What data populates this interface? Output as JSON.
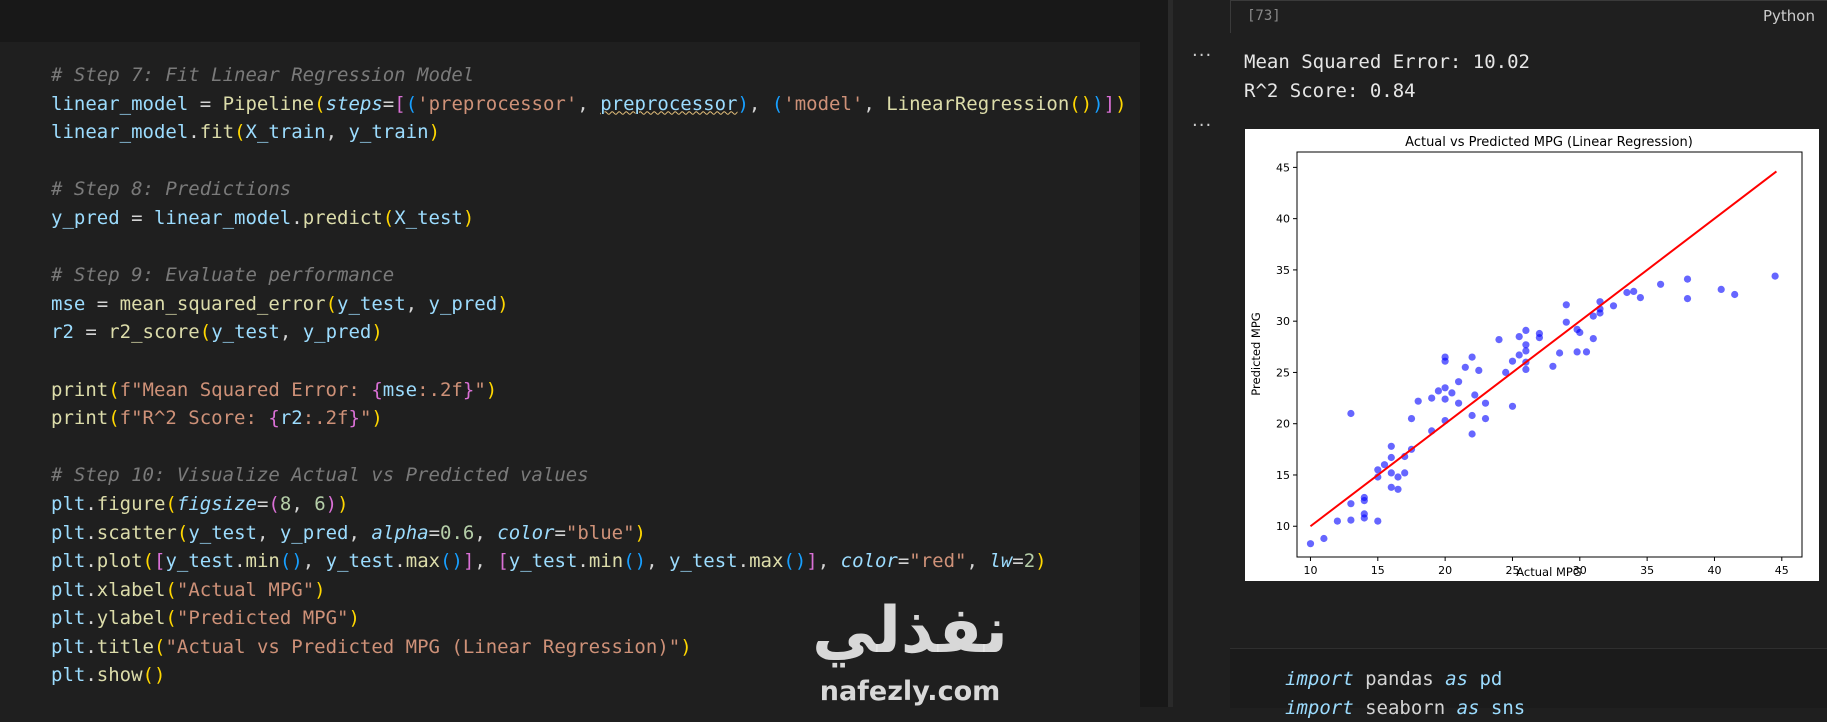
{
  "editor": {
    "lines": [
      {
        "segments": [
          {
            "t": "# Step 7: Fit Linear Regression Model",
            "c": "cm"
          }
        ]
      },
      {
        "segments": [
          {
            "t": "linear_model",
            "c": "v"
          },
          {
            "t": " = ",
            "c": "op"
          },
          {
            "t": "Pipeline",
            "c": "f"
          },
          {
            "t": "(",
            "c": "b1"
          },
          {
            "t": "steps",
            "c": "k"
          },
          {
            "t": "=",
            "c": "op"
          },
          {
            "t": "[",
            "c": "b2"
          },
          {
            "t": "(",
            "c": "b3"
          },
          {
            "t": "'preprocessor'",
            "c": "s"
          },
          {
            "t": ", ",
            "c": "op"
          },
          {
            "t": "preprocessor",
            "c": "v squig"
          },
          {
            "t": ")",
            "c": "b3"
          },
          {
            "t": ", ",
            "c": "op"
          },
          {
            "t": "(",
            "c": "b3"
          },
          {
            "t": "'model'",
            "c": "s"
          },
          {
            "t": ", ",
            "c": "op"
          },
          {
            "t": "LinearRegression",
            "c": "f"
          },
          {
            "t": "()",
            "c": "b1"
          },
          {
            "t": ")",
            "c": "b3"
          },
          {
            "t": "]",
            "c": "b2"
          },
          {
            "t": ")",
            "c": "b1"
          }
        ]
      },
      {
        "segments": [
          {
            "t": "linear_model",
            "c": "v"
          },
          {
            "t": ".",
            "c": "op"
          },
          {
            "t": "fit",
            "c": "f"
          },
          {
            "t": "(",
            "c": "b1"
          },
          {
            "t": "X_train",
            "c": "v"
          },
          {
            "t": ", ",
            "c": "op"
          },
          {
            "t": "y_train",
            "c": "v"
          },
          {
            "t": ")",
            "c": "b1"
          }
        ]
      },
      {
        "segments": []
      },
      {
        "segments": [
          {
            "t": "# Step 8: Predictions",
            "c": "cm"
          }
        ]
      },
      {
        "segments": [
          {
            "t": "y_pred",
            "c": "v"
          },
          {
            "t": " = ",
            "c": "op"
          },
          {
            "t": "linear_model",
            "c": "v"
          },
          {
            "t": ".",
            "c": "op"
          },
          {
            "t": "predict",
            "c": "f"
          },
          {
            "t": "(",
            "c": "b1"
          },
          {
            "t": "X_test",
            "c": "v"
          },
          {
            "t": ")",
            "c": "b1"
          }
        ]
      },
      {
        "segments": []
      },
      {
        "segments": [
          {
            "t": "# Step 9: Evaluate performance",
            "c": "cm"
          }
        ]
      },
      {
        "segments": [
          {
            "t": "mse",
            "c": "v"
          },
          {
            "t": " = ",
            "c": "op"
          },
          {
            "t": "mean_squared_error",
            "c": "f"
          },
          {
            "t": "(",
            "c": "b1"
          },
          {
            "t": "y_test",
            "c": "v"
          },
          {
            "t": ", ",
            "c": "op"
          },
          {
            "t": "y_pred",
            "c": "v"
          },
          {
            "t": ")",
            "c": "b1"
          }
        ]
      },
      {
        "segments": [
          {
            "t": "r2",
            "c": "v"
          },
          {
            "t": " = ",
            "c": "op"
          },
          {
            "t": "r2_score",
            "c": "f"
          },
          {
            "t": "(",
            "c": "b1"
          },
          {
            "t": "y_test",
            "c": "v"
          },
          {
            "t": ", ",
            "c": "op"
          },
          {
            "t": "y_pred",
            "c": "v"
          },
          {
            "t": ")",
            "c": "b1"
          }
        ]
      },
      {
        "segments": []
      },
      {
        "segments": [
          {
            "t": "print",
            "c": "f"
          },
          {
            "t": "(",
            "c": "b1"
          },
          {
            "t": "f\"Mean Squared Error: ",
            "c": "s"
          },
          {
            "t": "{",
            "c": "b2"
          },
          {
            "t": "mse",
            "c": "v"
          },
          {
            "t": ":.2f",
            "c": "s"
          },
          {
            "t": "}",
            "c": "b2"
          },
          {
            "t": "\"",
            "c": "s"
          },
          {
            "t": ")",
            "c": "b1"
          }
        ]
      },
      {
        "segments": [
          {
            "t": "print",
            "c": "f"
          },
          {
            "t": "(",
            "c": "b1"
          },
          {
            "t": "f\"R^2 Score: ",
            "c": "s"
          },
          {
            "t": "{",
            "c": "b2"
          },
          {
            "t": "r2",
            "c": "v"
          },
          {
            "t": ":.2f",
            "c": "s"
          },
          {
            "t": "}",
            "c": "b2"
          },
          {
            "t": "\"",
            "c": "s"
          },
          {
            "t": ")",
            "c": "b1"
          }
        ]
      },
      {
        "segments": []
      },
      {
        "segments": [
          {
            "t": "# Step 10: Visualize Actual vs Predicted values",
            "c": "cm"
          }
        ]
      },
      {
        "segments": [
          {
            "t": "plt",
            "c": "v"
          },
          {
            "t": ".",
            "c": "op"
          },
          {
            "t": "figure",
            "c": "f"
          },
          {
            "t": "(",
            "c": "b1"
          },
          {
            "t": "figsize",
            "c": "k"
          },
          {
            "t": "=",
            "c": "op"
          },
          {
            "t": "(",
            "c": "b2"
          },
          {
            "t": "8",
            "c": "n"
          },
          {
            "t": ", ",
            "c": "op"
          },
          {
            "t": "6",
            "c": "n"
          },
          {
            "t": ")",
            "c": "b2"
          },
          {
            "t": ")",
            "c": "b1"
          }
        ]
      },
      {
        "segments": [
          {
            "t": "plt",
            "c": "v"
          },
          {
            "t": ".",
            "c": "op"
          },
          {
            "t": "scatter",
            "c": "f"
          },
          {
            "t": "(",
            "c": "b1"
          },
          {
            "t": "y_test",
            "c": "v"
          },
          {
            "t": ", ",
            "c": "op"
          },
          {
            "t": "y_pred",
            "c": "v"
          },
          {
            "t": ", ",
            "c": "op"
          },
          {
            "t": "alpha",
            "c": "k"
          },
          {
            "t": "=",
            "c": "op"
          },
          {
            "t": "0.6",
            "c": "n"
          },
          {
            "t": ", ",
            "c": "op"
          },
          {
            "t": "color",
            "c": "k"
          },
          {
            "t": "=",
            "c": "op"
          },
          {
            "t": "\"blue\"",
            "c": "s"
          },
          {
            "t": ")",
            "c": "b1"
          }
        ]
      },
      {
        "segments": [
          {
            "t": "plt",
            "c": "v"
          },
          {
            "t": ".",
            "c": "op"
          },
          {
            "t": "plot",
            "c": "f"
          },
          {
            "t": "(",
            "c": "b1"
          },
          {
            "t": "[",
            "c": "b2"
          },
          {
            "t": "y_test",
            "c": "v"
          },
          {
            "t": ".",
            "c": "op"
          },
          {
            "t": "min",
            "c": "f"
          },
          {
            "t": "()",
            "c": "b3"
          },
          {
            "t": ", ",
            "c": "op"
          },
          {
            "t": "y_test",
            "c": "v"
          },
          {
            "t": ".",
            "c": "op"
          },
          {
            "t": "max",
            "c": "f"
          },
          {
            "t": "()",
            "c": "b3"
          },
          {
            "t": "]",
            "c": "b2"
          },
          {
            "t": ", ",
            "c": "op"
          },
          {
            "t": "[",
            "c": "b2"
          },
          {
            "t": "y_test",
            "c": "v"
          },
          {
            "t": ".",
            "c": "op"
          },
          {
            "t": "min",
            "c": "f"
          },
          {
            "t": "()",
            "c": "b3"
          },
          {
            "t": ", ",
            "c": "op"
          },
          {
            "t": "y_test",
            "c": "v"
          },
          {
            "t": ".",
            "c": "op"
          },
          {
            "t": "max",
            "c": "f"
          },
          {
            "t": "()",
            "c": "b3"
          },
          {
            "t": "]",
            "c": "b2"
          },
          {
            "t": ", ",
            "c": "op"
          },
          {
            "t": "color",
            "c": "k"
          },
          {
            "t": "=",
            "c": "op"
          },
          {
            "t": "\"red\"",
            "c": "s"
          },
          {
            "t": ", ",
            "c": "op"
          },
          {
            "t": "lw",
            "c": "k"
          },
          {
            "t": "=",
            "c": "op"
          },
          {
            "t": "2",
            "c": "n"
          },
          {
            "t": ")",
            "c": "b1"
          }
        ]
      },
      {
        "segments": [
          {
            "t": "plt",
            "c": "v"
          },
          {
            "t": ".",
            "c": "op"
          },
          {
            "t": "xlabel",
            "c": "f"
          },
          {
            "t": "(",
            "c": "b1"
          },
          {
            "t": "\"Actual MPG\"",
            "c": "s"
          },
          {
            "t": ")",
            "c": "b1"
          }
        ]
      },
      {
        "segments": [
          {
            "t": "plt",
            "c": "v"
          },
          {
            "t": ".",
            "c": "op"
          },
          {
            "t": "ylabel",
            "c": "f"
          },
          {
            "t": "(",
            "c": "b1"
          },
          {
            "t": "\"Predicted MPG\"",
            "c": "s"
          },
          {
            "t": ")",
            "c": "b1"
          }
        ]
      },
      {
        "segments": [
          {
            "t": "plt",
            "c": "v"
          },
          {
            "t": ".",
            "c": "op"
          },
          {
            "t": "title",
            "c": "f"
          },
          {
            "t": "(",
            "c": "b1"
          },
          {
            "t": "\"Actual vs Predicted MPG (Linear Regression)\"",
            "c": "s"
          },
          {
            "t": ")",
            "c": "b1"
          }
        ]
      },
      {
        "segments": [
          {
            "t": "plt",
            "c": "v"
          },
          {
            "t": ".",
            "c": "op"
          },
          {
            "t": "show",
            "c": "f"
          },
          {
            "t": "()",
            "c": "b1"
          }
        ]
      }
    ]
  },
  "cell": {
    "exec_count": "[73]",
    "language": "Python",
    "output_line_1": "Mean Squared Error: 10.02",
    "output_line_2": "R^2 Score: 0.84",
    "more_actions": "..."
  },
  "next_cell": {
    "line_1": [
      {
        "t": "import",
        "c": "k"
      },
      {
        "t": " pandas ",
        "c": "op"
      },
      {
        "t": "as",
        "c": "k"
      },
      {
        "t": " pd",
        "c": "v"
      }
    ],
    "line_2": [
      {
        "t": "import",
        "c": "k"
      },
      {
        "t": " seaborn ",
        "c": "op"
      },
      {
        "t": "as",
        "c": "k"
      },
      {
        "t": " sns",
        "c": "v"
      }
    ]
  },
  "watermark": {
    "arabic": "نفذلي",
    "latin": "nafezly.com"
  },
  "chart_data": {
    "type": "scatter",
    "title": "Actual vs Predicted MPG (Linear Regression)",
    "xlabel": "Actual MPG",
    "ylabel": "Predicted MPG",
    "xlim": [
      9,
      46.5
    ],
    "ylim": [
      7,
      46.5
    ],
    "xticks": [
      10,
      15,
      20,
      25,
      30,
      35,
      40,
      45
    ],
    "yticks": [
      10,
      15,
      20,
      25,
      30,
      35,
      40,
      45
    ],
    "grid": false,
    "colors": {
      "points": "#0000ff",
      "line": "#ff0000"
    },
    "reference_line": {
      "x": [
        10,
        44.6
      ],
      "y": [
        10,
        44.6
      ]
    },
    "points": [
      [
        10,
        8.3
      ],
      [
        11,
        8.8
      ],
      [
        12,
        10.5
      ],
      [
        13,
        21
      ],
      [
        13,
        10.6
      ],
      [
        13,
        12.2
      ],
      [
        14,
        11.2
      ],
      [
        14,
        12.8
      ],
      [
        14,
        10.8
      ],
      [
        14,
        12.5
      ],
      [
        15,
        10.5
      ],
      [
        15,
        14.8
      ],
      [
        15,
        15.5
      ],
      [
        15.5,
        16
      ],
      [
        16,
        16.7
      ],
      [
        16,
        13.8
      ],
      [
        16,
        15.2
      ],
      [
        16,
        17.8
      ],
      [
        16.5,
        14.8
      ],
      [
        16.5,
        13.6
      ],
      [
        17,
        16.8
      ],
      [
        17,
        15.2
      ],
      [
        17.5,
        17.5
      ],
      [
        17.5,
        20.5
      ],
      [
        18,
        22.2
      ],
      [
        19,
        19.3
      ],
      [
        19,
        22.5
      ],
      [
        19.5,
        23.2
      ],
      [
        20,
        20.3
      ],
      [
        20,
        22.4
      ],
      [
        20,
        23.5
      ],
      [
        20,
        26.5
      ],
      [
        20,
        26.1
      ],
      [
        20.5,
        23
      ],
      [
        21,
        22
      ],
      [
        21,
        24.1
      ],
      [
        21.5,
        25.5
      ],
      [
        22,
        26.5
      ],
      [
        22,
        19
      ],
      [
        22,
        20.8
      ],
      [
        22.2,
        22.8
      ],
      [
        22.5,
        25.2
      ],
      [
        23,
        20.5
      ],
      [
        23,
        22
      ],
      [
        24,
        28.2
      ],
      [
        24.5,
        25
      ],
      [
        25,
        21.7
      ],
      [
        25,
        26.1
      ],
      [
        25.5,
        26.7
      ],
      [
        25.5,
        28.5
      ],
      [
        26,
        27.1
      ],
      [
        26,
        27.7
      ],
      [
        26,
        26
      ],
      [
        26,
        25.3
      ],
      [
        26,
        29.1
      ],
      [
        27,
        28.4
      ],
      [
        27,
        28.8
      ],
      [
        28,
        25.6
      ],
      [
        28.5,
        26.9
      ],
      [
        29,
        29.9
      ],
      [
        29,
        31.6
      ],
      [
        29.8,
        29.2
      ],
      [
        29.8,
        27
      ],
      [
        30,
        28.9
      ],
      [
        30.5,
        27
      ],
      [
        31,
        28.3
      ],
      [
        31,
        30.5
      ],
      [
        31.5,
        31.2
      ],
      [
        31.5,
        31.9
      ],
      [
        31.5,
        30.8
      ],
      [
        32.5,
        31.5
      ],
      [
        33.5,
        32.8
      ],
      [
        34,
        32.9
      ],
      [
        34.5,
        32.3
      ],
      [
        36,
        33.6
      ],
      [
        38,
        34.1
      ],
      [
        38,
        32.2
      ],
      [
        40.5,
        33.1
      ],
      [
        41.5,
        32.6
      ],
      [
        44.5,
        34.4
      ]
    ]
  }
}
